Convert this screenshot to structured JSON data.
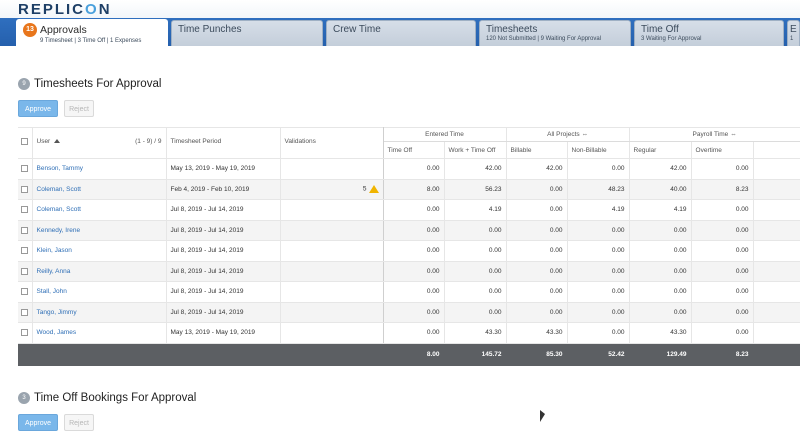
{
  "app": {
    "logo_pre": "REPLIC",
    "logo_o": "O",
    "logo_post": "N"
  },
  "tabs": [
    {
      "title": "Approvals",
      "sub": "9 Timesheet | 3 Time Off | 1 Expenses",
      "badge": "13",
      "active": true
    },
    {
      "title": "Time Punches",
      "sub": ""
    },
    {
      "title": "Crew Time",
      "sub": ""
    },
    {
      "title": "Timesheets",
      "sub": "120 Not Submitted | 9 Waiting For Approval"
    },
    {
      "title": "Time Off",
      "sub": "3 Waiting For Approval"
    },
    {
      "title": "E",
      "sub": "1"
    }
  ],
  "timesheets_section": {
    "badge": "9",
    "title": "Timesheets For Approval",
    "approve_label": "Approve",
    "reject_label": "Reject"
  },
  "table": {
    "headers": {
      "user": "User",
      "range": "(1 - 9) / 9",
      "period": "Timesheet Period",
      "validations": "Validations",
      "entered_time": "Entered Time",
      "all_projects": "All Projects",
      "payroll_time": "Payroll Time",
      "time_off": "Time Off",
      "work_time_off": "Work + Time Off",
      "billable": "Billable",
      "non_billable": "Non-Billable",
      "regular": "Regular",
      "overtime": "Overtime"
    },
    "rows": [
      {
        "user": "Benson, Tammy",
        "period": "May 13, 2019 - May 19, 2019",
        "validations": "",
        "time_off": "0.00",
        "work": "42.00",
        "billable": "42.00",
        "non_billable": "0.00",
        "regular": "42.00",
        "overtime": "0.00"
      },
      {
        "user": "Coleman, Scott",
        "period": "Feb 4, 2019 - Feb 10, 2019",
        "validations": "5",
        "time_off": "8.00",
        "work": "56.23",
        "billable": "0.00",
        "non_billable": "48.23",
        "regular": "40.00",
        "overtime": "8.23"
      },
      {
        "user": "Coleman, Scott",
        "period": "Jul 8, 2019 - Jul 14, 2019",
        "validations": "",
        "time_off": "0.00",
        "work": "4.19",
        "billable": "0.00",
        "non_billable": "4.19",
        "regular": "4.19",
        "overtime": "0.00"
      },
      {
        "user": "Kennedy, Irene",
        "period": "Jul 8, 2019 - Jul 14, 2019",
        "validations": "",
        "time_off": "0.00",
        "work": "0.00",
        "billable": "0.00",
        "non_billable": "0.00",
        "regular": "0.00",
        "overtime": "0.00"
      },
      {
        "user": "Klein, Jason",
        "period": "Jul 8, 2019 - Jul 14, 2019",
        "validations": "",
        "time_off": "0.00",
        "work": "0.00",
        "billable": "0.00",
        "non_billable": "0.00",
        "regular": "0.00",
        "overtime": "0.00"
      },
      {
        "user": "Reilly, Anna",
        "period": "Jul 8, 2019 - Jul 14, 2019",
        "validations": "",
        "time_off": "0.00",
        "work": "0.00",
        "billable": "0.00",
        "non_billable": "0.00",
        "regular": "0.00",
        "overtime": "0.00"
      },
      {
        "user": "Stall, John",
        "period": "Jul 8, 2019 - Jul 14, 2019",
        "validations": "",
        "time_off": "0.00",
        "work": "0.00",
        "billable": "0.00",
        "non_billable": "0.00",
        "regular": "0.00",
        "overtime": "0.00"
      },
      {
        "user": "Tango, Jimmy",
        "period": "Jul 8, 2019 - Jul 14, 2019",
        "validations": "",
        "time_off": "0.00",
        "work": "0.00",
        "billable": "0.00",
        "non_billable": "0.00",
        "regular": "0.00",
        "overtime": "0.00"
      },
      {
        "user": "Wood, James",
        "period": "May 13, 2019 - May 19, 2019",
        "validations": "",
        "time_off": "0.00",
        "work": "43.30",
        "billable": "43.30",
        "non_billable": "0.00",
        "regular": "43.30",
        "overtime": "0.00"
      }
    ],
    "totals": {
      "time_off": "8.00",
      "work": "145.72",
      "billable": "85.30",
      "non_billable": "52.42",
      "regular": "129.49",
      "overtime": "8.23"
    }
  },
  "timeoff_section": {
    "badge": "3",
    "title": "Time Off Bookings For Approval",
    "approve_label": "Approve",
    "reject_label": "Reject"
  },
  "colors": {
    "tabbar": "#2560ad",
    "primary_button": "#7ab7ea",
    "badge_orange": "#e8761c",
    "link": "#2f6fb6",
    "totals_row": "#5c5f63",
    "warning": "#f0b400"
  }
}
